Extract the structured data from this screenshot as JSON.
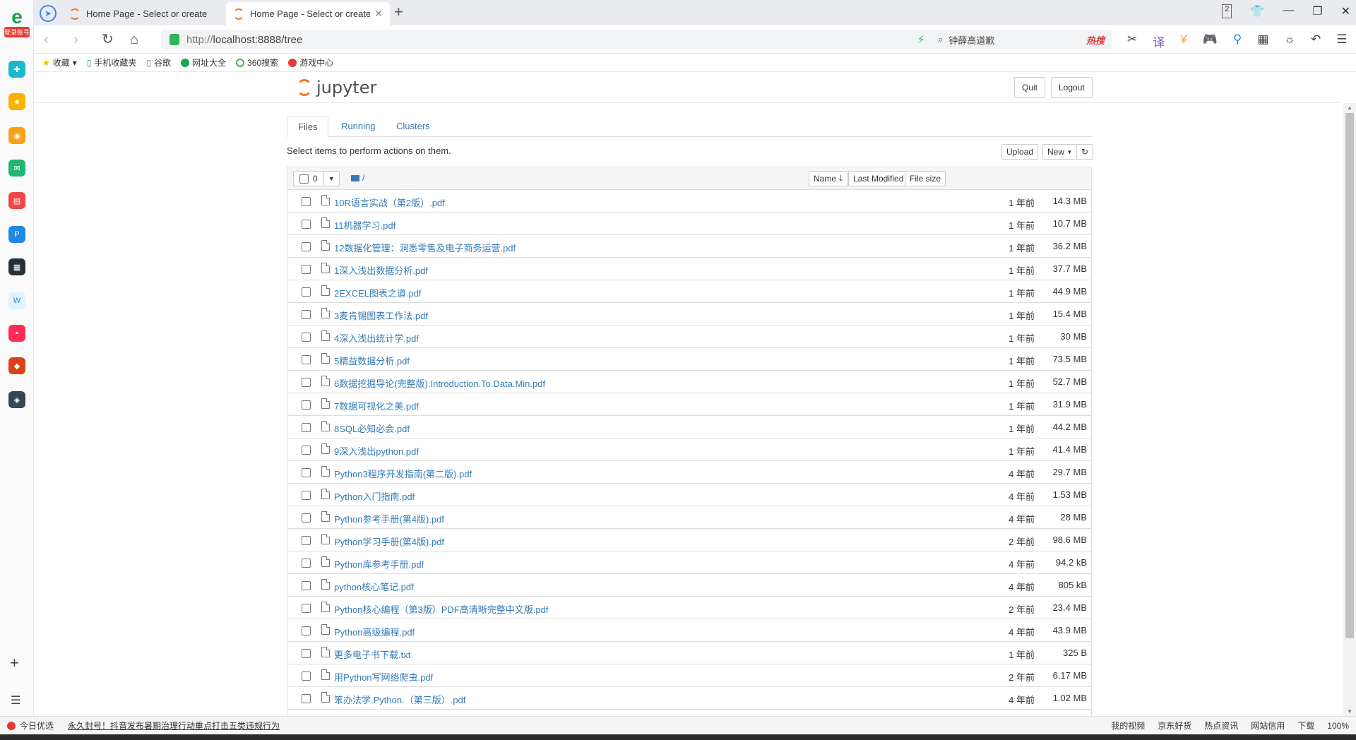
{
  "browser": {
    "tabs": [
      {
        "label": "Home Page - Select or create"
      },
      {
        "label": "Home Page - Select or create"
      }
    ],
    "url_proto": "http://",
    "url_rest": "localhost:8888/tree",
    "search_text": "钟薛高道歉",
    "search_hot": "热搜",
    "bookmarks": [
      "收藏",
      "手机收藏夹",
      "谷歌",
      "网址大全",
      "360搜索",
      "游戏中心"
    ],
    "sidebar_tag": "登录账号",
    "window_badge": "2"
  },
  "jupyter": {
    "logo_text": "jupyter",
    "quit_label": "Quit",
    "logout_label": "Logout",
    "tabs": [
      "Files",
      "Running",
      "Clusters"
    ],
    "hint": "Select items to perform actions on them.",
    "upload_label": "Upload",
    "new_label": "New",
    "selected_count": "0",
    "path": "/",
    "columns": {
      "name": "Name",
      "modified": "Last Modified",
      "size": "File size"
    },
    "files": [
      {
        "name": "10R语言实战（第2版）.pdf",
        "modified": "1 年前",
        "size": "14.3 MB"
      },
      {
        "name": "11机器学习.pdf",
        "modified": "1 年前",
        "size": "10.7 MB"
      },
      {
        "name": "12数据化管理：洞悉零售及电子商务运营.pdf",
        "modified": "1 年前",
        "size": "36.2 MB"
      },
      {
        "name": "1深入浅出数据分析.pdf",
        "modified": "1 年前",
        "size": "37.7 MB"
      },
      {
        "name": "2EXCEL图表之道.pdf",
        "modified": "1 年前",
        "size": "44.9 MB"
      },
      {
        "name": "3麦肯锡图表工作法.pdf",
        "modified": "1 年前",
        "size": "15.4 MB"
      },
      {
        "name": "4深入浅出统计学.pdf",
        "modified": "1 年前",
        "size": "30 MB"
      },
      {
        "name": "5精益数据分析.pdf",
        "modified": "1 年前",
        "size": "73.5 MB"
      },
      {
        "name": "6数据挖掘导论(完整版).Introduction.To.Data.Min.pdf",
        "modified": "1 年前",
        "size": "52.7 MB"
      },
      {
        "name": "7数据可视化之美.pdf",
        "modified": "1 年前",
        "size": "31.9 MB"
      },
      {
        "name": "8SQL必知必会.pdf",
        "modified": "1 年前",
        "size": "44.2 MB"
      },
      {
        "name": "9深入浅出python.pdf",
        "modified": "1 年前",
        "size": "41.4 MB"
      },
      {
        "name": "Python3程序开发指南(第二版).pdf",
        "modified": "4 年前",
        "size": "29.7 MB"
      },
      {
        "name": "Python入门指南.pdf",
        "modified": "4 年前",
        "size": "1.53 MB"
      },
      {
        "name": "Python参考手册(第4版).pdf",
        "modified": "4 年前",
        "size": "28 MB"
      },
      {
        "name": "Python学习手册(第4版).pdf",
        "modified": "2 年前",
        "size": "98.6 MB"
      },
      {
        "name": "Python库参考手册.pdf",
        "modified": "4 年前",
        "size": "94.2 kB"
      },
      {
        "name": "python核心笔记.pdf",
        "modified": "4 年前",
        "size": "805 kB"
      },
      {
        "name": "Python核心编程（第3版）PDF高清晰完整中文版.pdf",
        "modified": "2 年前",
        "size": "23.4 MB"
      },
      {
        "name": "Python高级编程.pdf",
        "modified": "4 年前",
        "size": "43.9 MB"
      },
      {
        "name": "更多电子书下载.txt",
        "modified": "1 年前",
        "size": "325 B"
      },
      {
        "name": "用Python写网络爬虫.pdf",
        "modified": "2 年前",
        "size": "6.17 MB"
      },
      {
        "name": "笨办法学.Python.（第三版）.pdf",
        "modified": "4 年前",
        "size": "1.02 MB"
      }
    ]
  },
  "statusbar": {
    "left_label": "今日优选",
    "news": "永久封号！抖音发布暑期治理行动重点打击五类违规行为",
    "right_items": [
      "我的视频",
      "京东好货",
      "热点资讯",
      "网站信用",
      "下载",
      "100%"
    ]
  },
  "colors": {
    "link": "#337ab7",
    "jupyter_orange": "#f37626",
    "hot": "#e53935"
  }
}
